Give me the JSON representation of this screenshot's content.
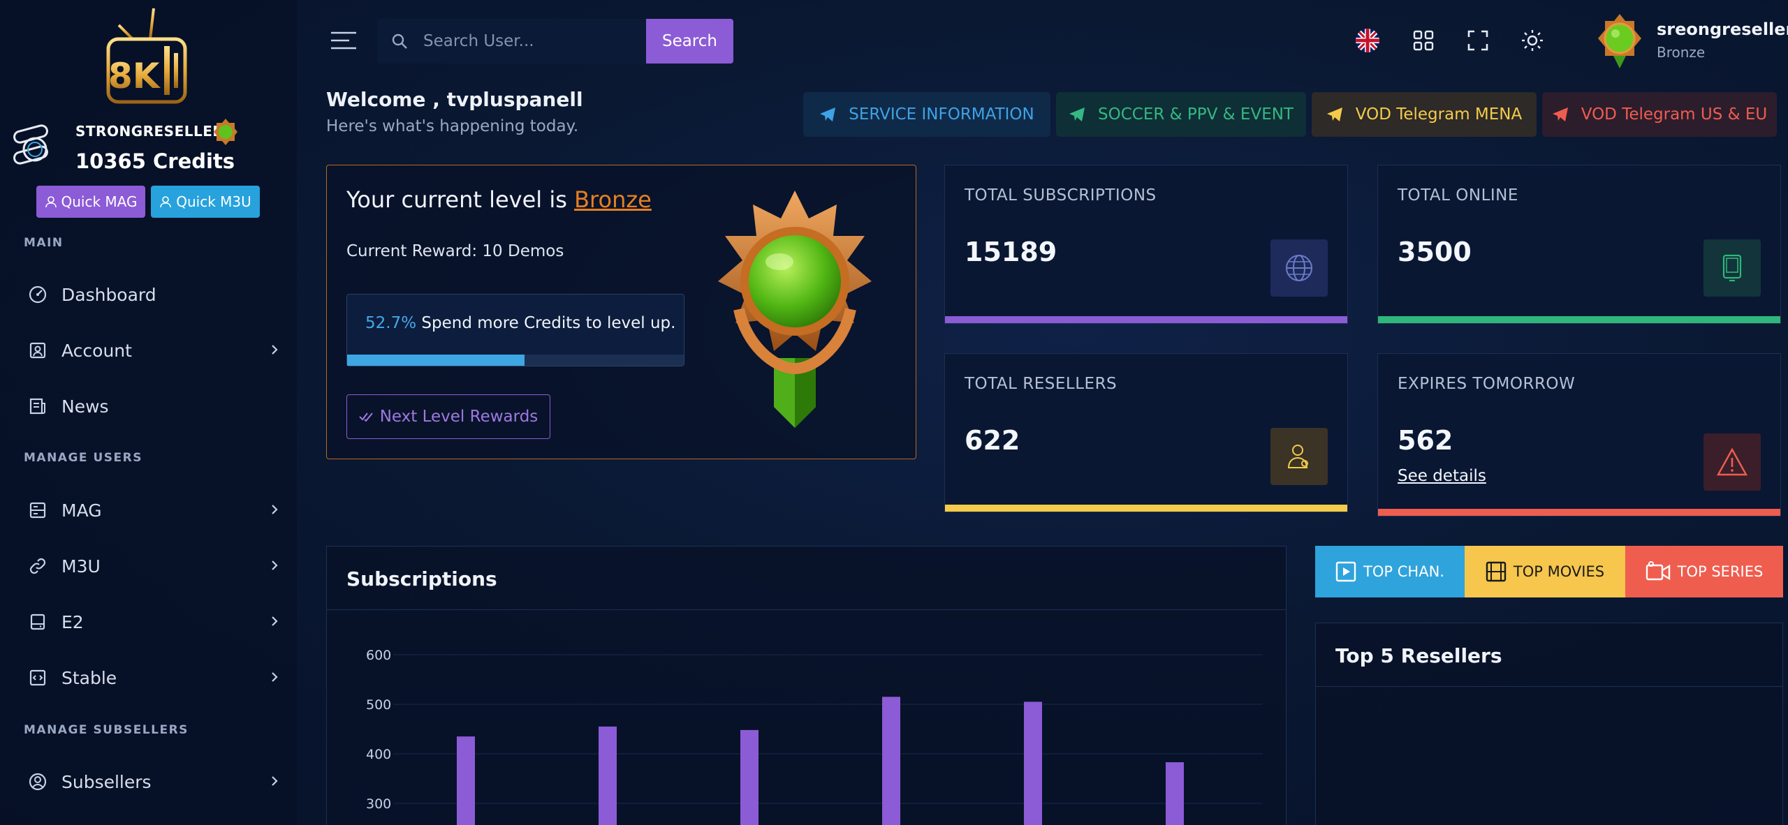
{
  "sidebar": {
    "reseller_name": "STRONGRESELLER",
    "credits": "10365 Credits",
    "quick_mag": "Quick MAG",
    "quick_m3u": "Quick M3U",
    "sections": {
      "main": "MAIN",
      "manage_users": "MANAGE USERS",
      "manage_subsellers": "MANAGE SUBSELLERS"
    },
    "items": [
      {
        "label": "Dashboard",
        "icon": "gauge-icon"
      },
      {
        "label": "Account",
        "icon": "user-card-icon"
      },
      {
        "label": "News",
        "icon": "newspaper-icon"
      },
      {
        "label": "MAG",
        "icon": "server-icon"
      },
      {
        "label": "M3U",
        "icon": "link-icon"
      },
      {
        "label": "E2",
        "icon": "hard-drive-icon"
      },
      {
        "label": "Stable",
        "icon": "code-file-icon"
      },
      {
        "label": "Subsellers",
        "icon": "user-circle-icon"
      }
    ]
  },
  "topbar": {
    "search_placeholder": "Search User...",
    "search_button": "Search",
    "user_name": "sreongreseller",
    "user_rank": "Bronze"
  },
  "welcome": {
    "title": "Welcome , tvpluspanell",
    "subtitle": "Here's what's happening today."
  },
  "channels": [
    {
      "label": "SERVICE INFORMATION",
      "color": "#3fa2e6",
      "bg": "#0f2a48"
    },
    {
      "label": "SOCCER & PPV & EVENT",
      "color": "#35b884",
      "bg": "#0e2f36"
    },
    {
      "label": "VOD Telegram MENA",
      "color": "#f4cb4b",
      "bg": "#2d2a27"
    },
    {
      "label": "VOD Telegram US & EU",
      "color": "#ef5d4f",
      "bg": "#2c1d2c"
    }
  ],
  "level": {
    "prefix": "Your current level is ",
    "rank": "Bronze",
    "reward": "Current Reward: 10 Demos",
    "progress_pct": "52.7%",
    "progress_value": 0.527,
    "progress_text": " Spend more Credits to level up.",
    "next_button": "Next Level Rewards"
  },
  "stats": [
    {
      "label": "TOTAL SUBSCRIPTIONS",
      "value": "15189",
      "color": "#8c5bd6",
      "icon": "globe-icon"
    },
    {
      "label": "TOTAL ONLINE",
      "value": "3500",
      "color": "#2fb67a",
      "icon": "tablet-icon"
    },
    {
      "label": "TOTAL RESELLERS",
      "value": "622",
      "color": "#f4cb4b",
      "icon": "user-badge-icon"
    },
    {
      "label": "EXPIRES TOMORROW",
      "value": "562",
      "color": "#ef5d4f",
      "icon": "warning-icon",
      "link": "See details"
    }
  ],
  "subscriptions_card": {
    "title": "Subscriptions"
  },
  "chart_data": {
    "type": "bar",
    "title": "Subscriptions",
    "yticks": [
      300,
      400,
      500,
      600
    ],
    "ylim": [
      300,
      640
    ],
    "series": [
      {
        "values": [
          435,
          455,
          448,
          515,
          505,
          383
        ]
      }
    ],
    "bar_color": "#8c5bd6"
  },
  "tabs": [
    {
      "label": "TOP CHAN.",
      "bg": "#2fa3dc",
      "icon": "play-icon"
    },
    {
      "label": "TOP MOVIES",
      "bg": "#f6c64d",
      "icon": "film-icon"
    },
    {
      "label": "TOP SERIES",
      "bg": "#ef5d4f",
      "icon": "video-icon"
    }
  ],
  "top5": {
    "title": "Top 5 Resellers"
  }
}
